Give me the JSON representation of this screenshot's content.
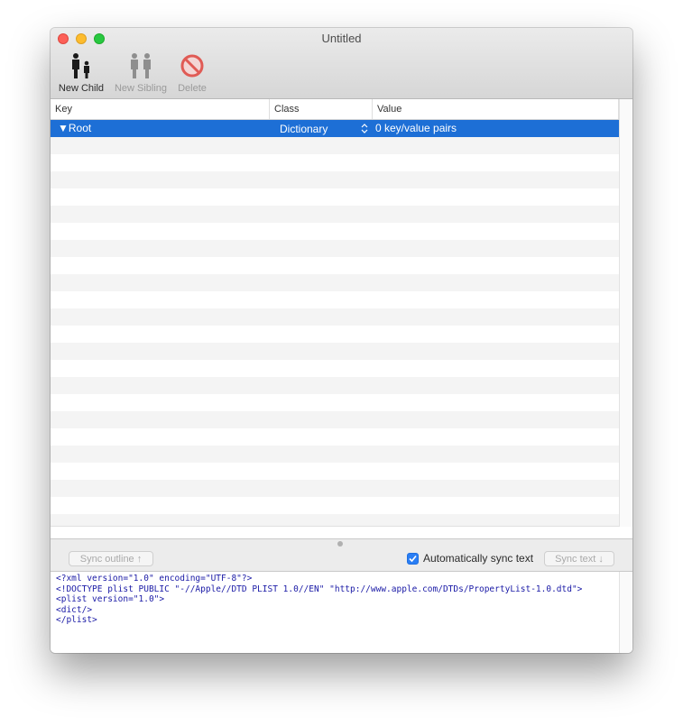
{
  "window": {
    "title": "Untitled"
  },
  "toolbar": {
    "new_child": "New Child",
    "new_sibling": "New Sibling",
    "delete": "Delete"
  },
  "table": {
    "headers": {
      "key": "Key",
      "class": "Class",
      "value": "Value"
    },
    "root_row": {
      "key": "▼Root",
      "class": "Dictionary",
      "value": "0 key/value pairs"
    }
  },
  "sync": {
    "outline_button": "Sync outline ↑",
    "auto_sync_label": "Automatically sync text",
    "auto_sync_checked": true,
    "text_button": "Sync text ↓"
  },
  "xml_text": "<?xml version=\"1.0\" encoding=\"UTF-8\"?>\n<!DOCTYPE plist PUBLIC \"-//Apple//DTD PLIST 1.0//EN\" \"http://www.apple.com/DTDs/PropertyList-1.0.dtd\">\n<plist version=\"1.0\">\n<dict/>\n</plist>",
  "colors": {
    "selection": "#1d6fd6",
    "close": "#fc5f57",
    "minimize": "#fdbc2e",
    "zoom": "#28c840",
    "delete_icon": "#e05b55",
    "xml_text": "#1a1aa6"
  },
  "icons": {
    "new_child": "parent-child-figures-icon",
    "new_sibling": "sibling-figures-icon",
    "delete": "no-entry-icon",
    "checkbox": "checkmark-icon",
    "class_stepper": "up-down-stepper-icon"
  }
}
